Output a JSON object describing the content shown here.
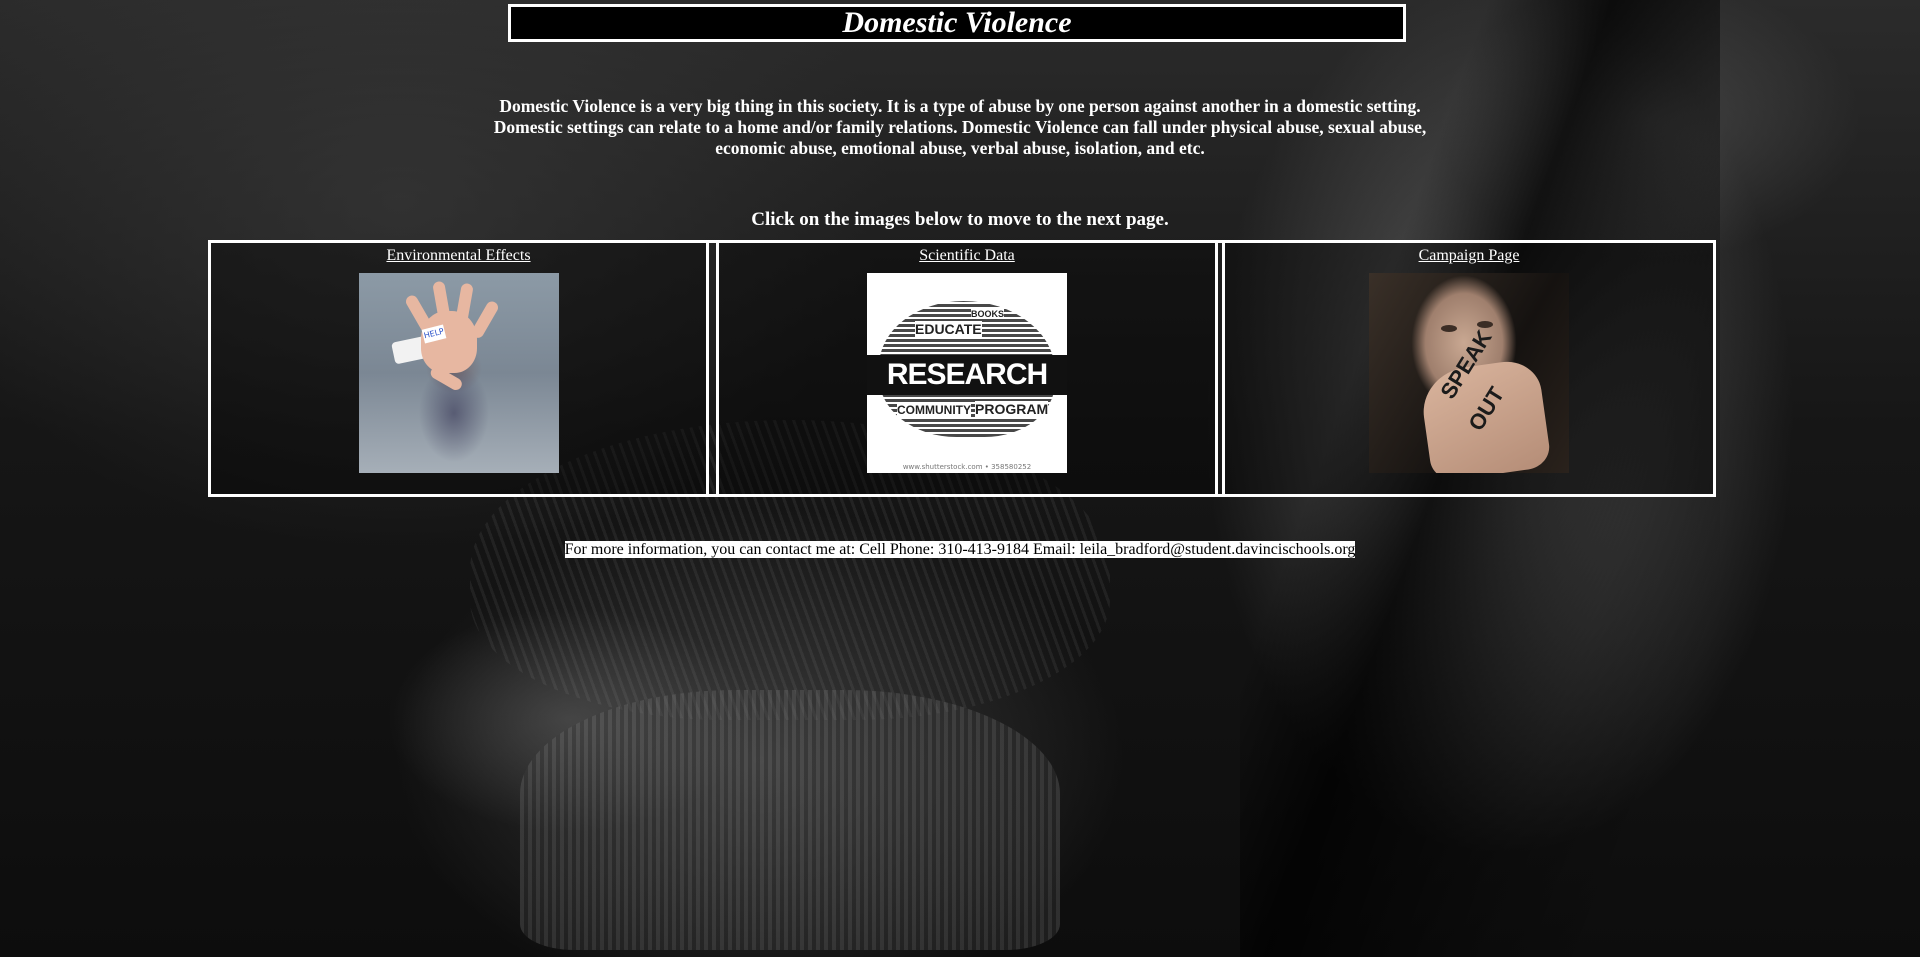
{
  "page": {
    "title": "Domestic Violence",
    "intro": "Domestic Violence is a very big thing in this society. It is a type of abuse by one person against another in a domestic setting. Domestic settings can relate to a home and/or family relations. Domestic Violence can fall under physical abuse, sexual abuse, economic abuse, emotional abuse, verbal abuse, isolation, and etc.",
    "instruction": "Click on the images below to move to the next page."
  },
  "links": [
    {
      "label": "Environmental Effects",
      "image": "hand-on-glass-help-image"
    },
    {
      "label": "Scientific Data",
      "image": "research-word-cloud-image"
    },
    {
      "label": "Campaign Page",
      "image": "speak-out-image"
    }
  ],
  "thumbnails": {
    "help_note": "HELP",
    "research_word": "RESEARCH",
    "research_words": [
      "EDUCATE",
      "BOOKS",
      "COMMUNITY",
      "PROGRAM"
    ],
    "credit": "www.shutterstock.com • 358580252",
    "speak": "SPEAK",
    "out": "OUT"
  },
  "contact": {
    "text": "For more information, you can contact me at: Cell Phone: 310-413-9184 Email: leila_bradford@student.davincischools.org"
  },
  "colors": {
    "text": "#ffffff",
    "border": "#ffffff",
    "title_bg": "#000000",
    "contact_bg": "#ffffff",
    "contact_text": "#000000"
  }
}
